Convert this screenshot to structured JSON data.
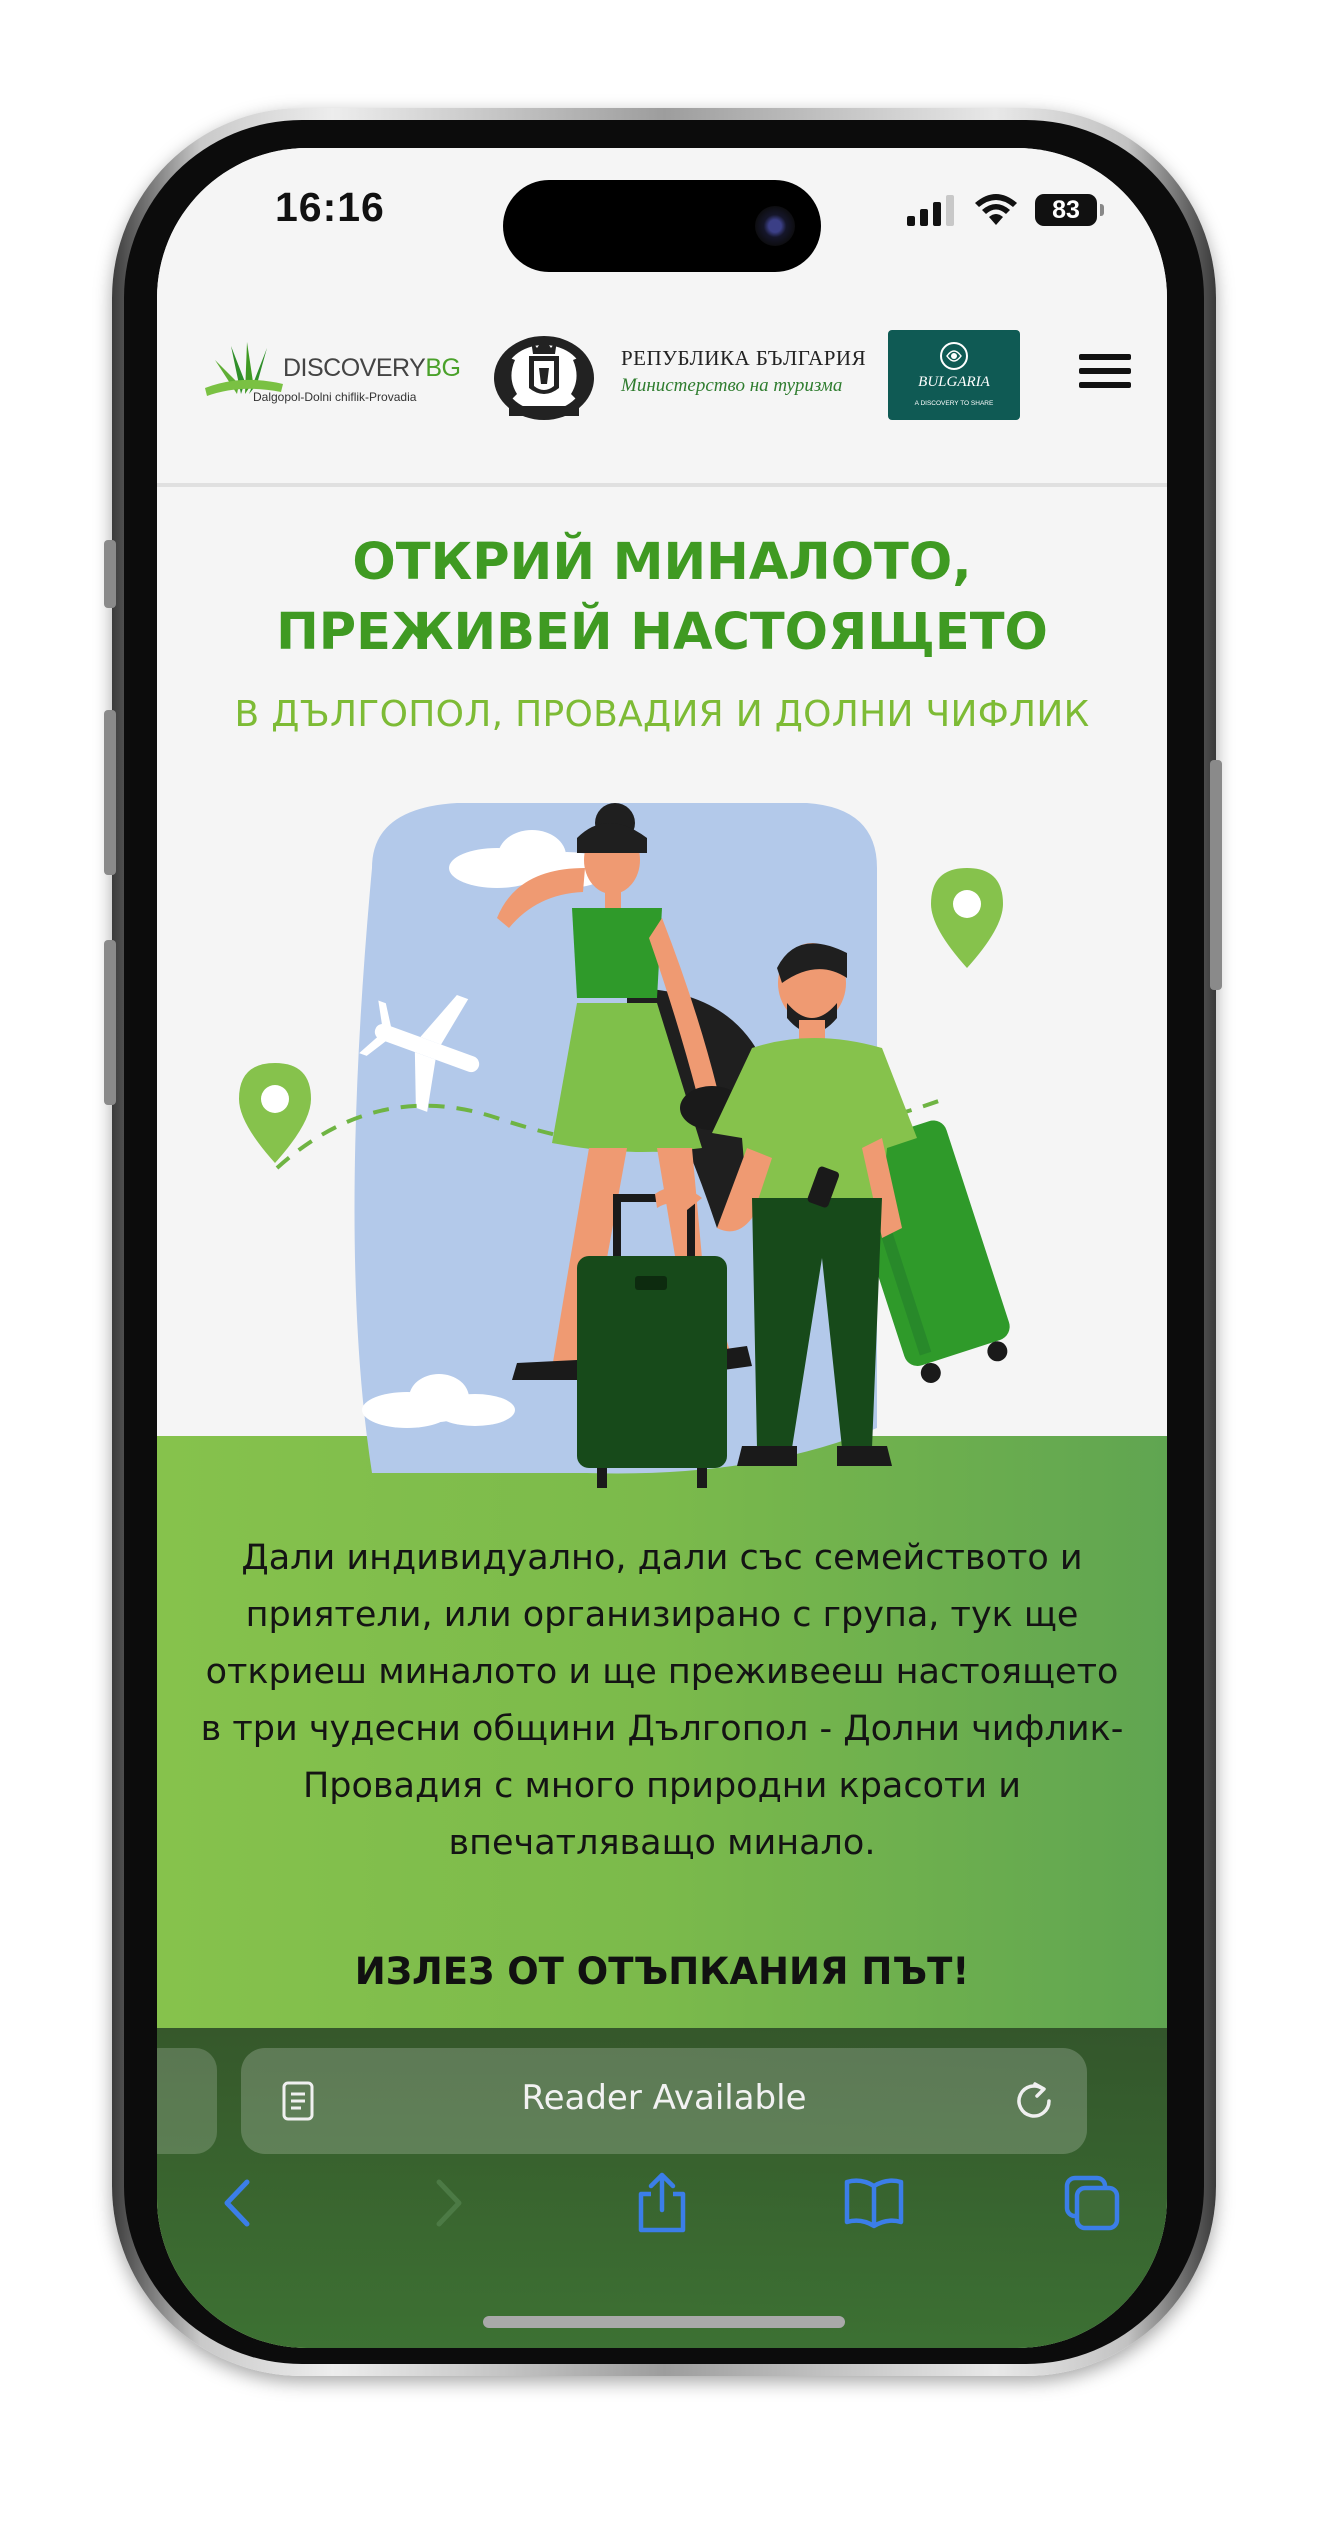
{
  "status_bar": {
    "time": "16:16",
    "battery": "83"
  },
  "header": {
    "logo_discovery": {
      "name": "DISCOVERY",
      "suffix": "BG",
      "tagline": "Dalgopol-Dolni chiflik-Provadia"
    },
    "ministry": {
      "line1": "РЕПУБЛИКА БЪЛГАРИЯ",
      "line2": "Министерство на туризма"
    },
    "bulgaria_badge": {
      "word": "BULGARIA",
      "slogan": "A DISCOVERY TO SHARE"
    }
  },
  "hero": {
    "title_line1": "ОТКРИЙ МИНАЛОТО,",
    "title_line2": "ПРЕЖИВЕЙ НАСТОЯЩЕТО",
    "subtitle": "В ДЪЛГОПОЛ, ПРОВАДИЯ И ДОЛНИ ЧИФЛИК"
  },
  "intro": {
    "text": "Дали индивидуално, дали със семейството и приятели, или организирано с група, тук ще откриеш миналото и ще преживееш настоящето в три чудесни общини Дългопол - Долни чифлик- Провадия с много природни красоти и впечатляващо минало.",
    "cta": "ИЗЛЕЗ ОТ ОТЪПКАНИЯ ПЪТ!"
  },
  "browser": {
    "address_bar_label": "Reader Available",
    "icon_color": "#3b7ee8"
  },
  "colors": {
    "brand_green": "#3f9a22",
    "light_green": "#7dbb35",
    "section_green": "#7bba4b",
    "dark_green": "#1d4a1a"
  }
}
